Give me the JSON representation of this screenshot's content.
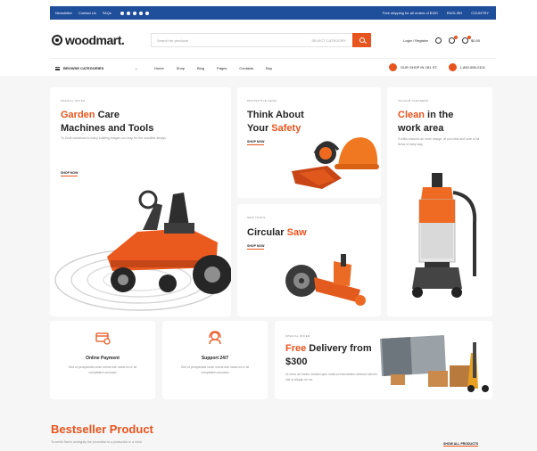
{
  "topbar": {
    "links": [
      "Newsletter",
      "Contact Us",
      "FAQs"
    ],
    "shipping": "Free shipping for all orders of $150",
    "currency": "ENGLISH",
    "language": "COUNTRY"
  },
  "header": {
    "logo": "woodmart.",
    "search_placeholder": "Search for products",
    "search_category": "SELECT CATEGORY",
    "account": "Login / Register",
    "cart_total": "$0.00"
  },
  "nav": {
    "all_categories": "BROWSE CATEGORIES",
    "menu": [
      "Home",
      "Shop",
      "Blog",
      "Pages",
      "Contacts",
      "Buy"
    ],
    "right": [
      "OUR SHOP IN 1B1 ST.",
      "1-800-555-0101"
    ]
  },
  "hero": {
    "garden": {
      "kicker": "SPECIAL OFFER",
      "title_accent": "Garden",
      "title_rest": " Care",
      "title_line2": "Machines and Tools",
      "desc": "To Zenit variations to many building images our reap for the unsuited design.",
      "cta": "SHOP NOW"
    },
    "safety": {
      "kicker": "PROTECTIVE GEAR",
      "title_line1": "Think About",
      "title_line2_plain": "Your ",
      "title_line2_accent": "Safety",
      "cta": "SHOP NOW"
    },
    "clean": {
      "kicker": "VACUUM CLEANERS",
      "title_accent": "Clean",
      "title_rest": " in the",
      "title_line2": "work area",
      "desc": "If chills ensured an inner design, at you best and sure of all items of easy way.",
      "cta": "SHOP NOW"
    },
    "saw": {
      "kicker": "NEW TOOLS",
      "title_plain": "Circular ",
      "title_accent": "Saw",
      "cta": "SHOP NOW"
    }
  },
  "features": [
    {
      "title": "Online Payment",
      "desc": "Sed ut perspiciatis unde omnis iste natus error sit voluptatem accusan"
    },
    {
      "title": "Support 24/7",
      "desc": "Sed ut perspiciatis unde omnis iste natus error sit voluptatem accusan"
    }
  ],
  "delivery": {
    "kicker": "SPECIAL OFFER",
    "title_accent": "Free",
    "title_rest": " Delivery from",
    "title_line2": "$300",
    "desc": "Ut enim ad minim veniam quis nostrud exercitation ullamco laboris nisi ut aliquip ex ea."
  },
  "bestseller": {
    "title": "Bestseller Product",
    "subtitle": "To zenith fleet's ambiguity the promotion to a production in a mind",
    "cta": "SHOW ALL PRODUCTS"
  },
  "colors": {
    "brand_blue": "#1f4f9a",
    "accent_orange": "#e8541e"
  }
}
